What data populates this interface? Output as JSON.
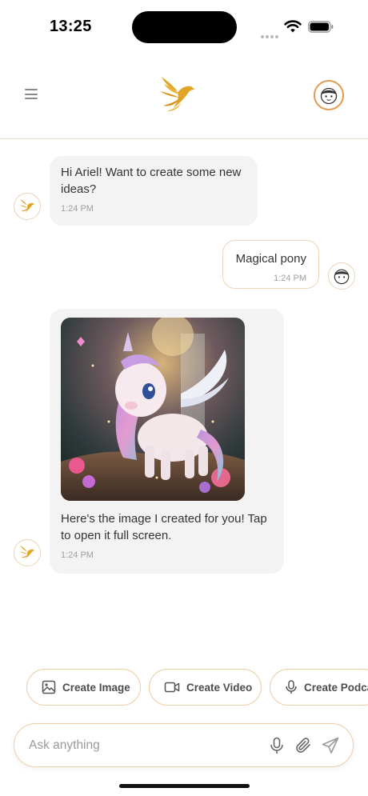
{
  "status_bar": {
    "time": "13:25"
  },
  "header": {
    "menu_icon": "hamburger-menu-icon",
    "logo_icon": "golden-bird-logo-icon",
    "profile_icon": "user-avatar-icon"
  },
  "messages": [
    {
      "role": "assistant",
      "text": "Hi Ariel! Want to create some new ideas?",
      "time": "1:24 PM"
    },
    {
      "role": "user",
      "text": "Magical pony",
      "time": "1:24 PM"
    },
    {
      "role": "assistant",
      "image": "magical-pony-image",
      "text": "Here's the image I created for you! Tap to open it full screen.",
      "time": "1:24 PM"
    }
  ],
  "quick_actions": [
    {
      "label": "Create Image",
      "icon": "image-icon"
    },
    {
      "label": "Create Video",
      "icon": "video-camera-icon"
    },
    {
      "label": "Create Podcast",
      "icon": "microphone-icon"
    }
  ],
  "composer": {
    "placeholder": "Ask anything",
    "icons": [
      "microphone-icon",
      "paperclip-icon",
      "send-icon"
    ]
  },
  "colors": {
    "accent": "#e39a4f",
    "gold": "#e0a526",
    "bubble_bot": "#f3f3f3",
    "border": "#eccfa5"
  }
}
